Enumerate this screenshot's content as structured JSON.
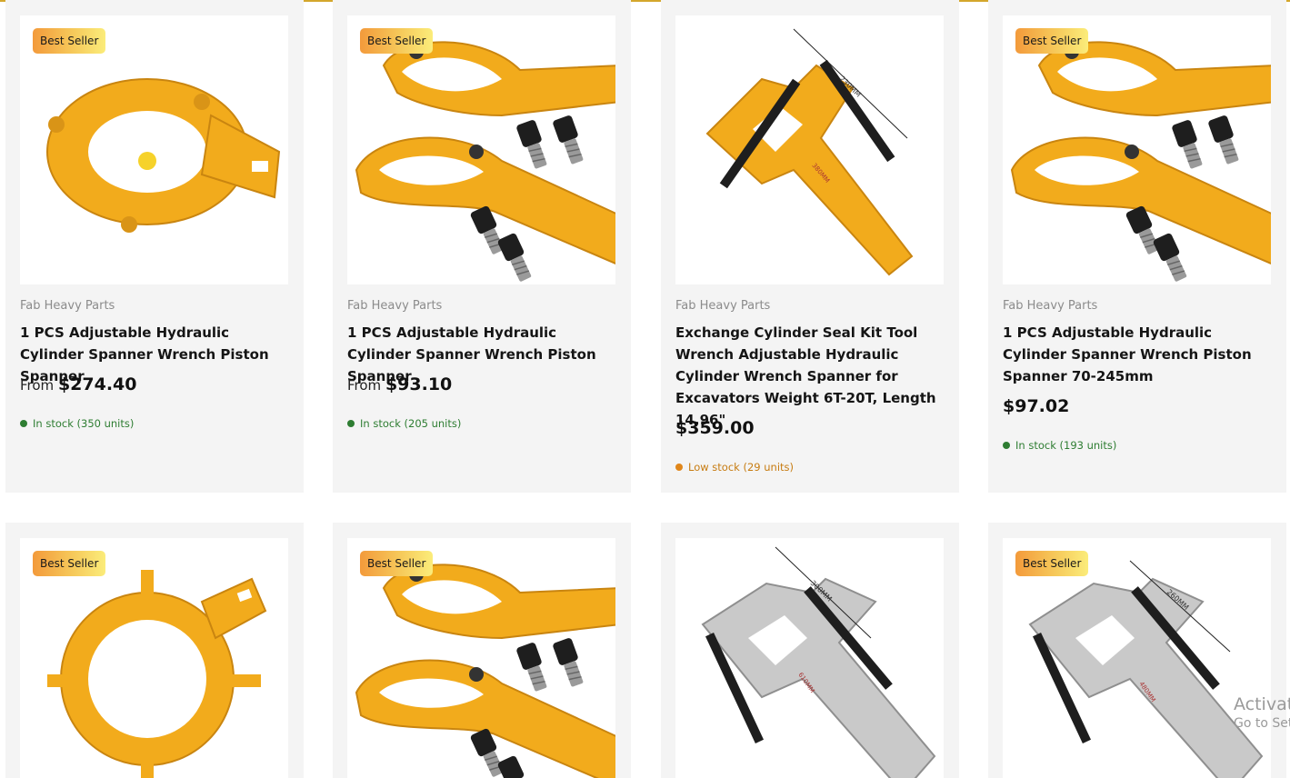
{
  "products": [
    {
      "badge": "Best Seller",
      "vendor": "Fab Heavy Parts",
      "title": "1 PCS Adjustable Hydraulic Cylinder Spanner Wrench Piston Spanner",
      "price_prefix": "From",
      "price": "$274.40",
      "stock": "In stock (350 units)",
      "stock_status": "in"
    },
    {
      "badge": "Best Seller",
      "vendor": "Fab Heavy Parts",
      "title": "1 PCS Adjustable Hydraulic Cylinder Spanner Wrench Piston Spanner",
      "price_prefix": "From",
      "price": "$93.10",
      "stock": "In stock (205 units)",
      "stock_status": "in"
    },
    {
      "badge": "",
      "vendor": "Fab Heavy Parts",
      "title": "Exchange Cylinder Seal Kit Tool Wrench Adjustable Hydraulic Cylinder Wrench Spanner for Excavators Weight 6T-20T, Length 14.96\"",
      "price_prefix": "",
      "price": "$359.00",
      "stock": "Low stock (29 units)",
      "stock_status": "low",
      "dim_a": "230MM",
      "dim_b": "380MM"
    },
    {
      "badge": "Best Seller",
      "vendor": "Fab Heavy Parts",
      "title": "1 PCS Adjustable Hydraulic Cylinder Spanner Wrench Piston Spanner 70-245mm",
      "price_prefix": "",
      "price": "$97.02",
      "stock": "In stock (193 units)",
      "stock_status": "in"
    },
    {
      "badge": "Best Seller"
    },
    {
      "badge": "Best Seller"
    },
    {
      "badge": "",
      "dim_a": "300MM",
      "dim_b": "610MM"
    },
    {
      "badge": "Best Seller",
      "dim_a": "260MM",
      "dim_b": "480MM"
    }
  ],
  "colors": {
    "wrench_yellow": "#f2ab1c",
    "steel_gray": "#bdbdbd",
    "in_stock": "#2e7d32",
    "low_stock": "#e0861a",
    "accent_line": "#d4a72c"
  },
  "watermark": {
    "line1": "Activat",
    "line2": "Go to Set"
  }
}
